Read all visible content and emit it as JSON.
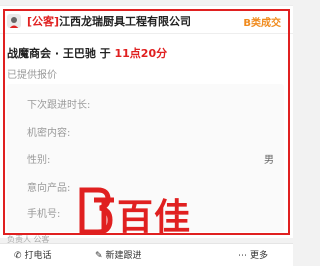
{
  "header": {
    "tag": "[公客]",
    "company": "江西龙瑞厨具工程有限公司",
    "category_badge": "B类成交"
  },
  "activity": {
    "prefix": "战魔商会 · 王巴驰 于 ",
    "time": "11点20分"
  },
  "status_text": "已提供报价",
  "fields": [
    {
      "label": "下次跟进时长:",
      "value": ""
    },
    {
      "label": "机密内容:",
      "value": ""
    },
    {
      "label": "性别:",
      "value": "男"
    },
    {
      "label": "意向产品:",
      "value": ""
    },
    {
      "label": "手机号:",
      "value": ""
    }
  ],
  "owner_label": "负责人 公客",
  "bottom_bar": {
    "call_label": "打电话",
    "new_followup_label": "新建跟进",
    "more_label": "更多"
  },
  "watermark": {
    "text": "百佳"
  },
  "colors": {
    "accent_red": "#e02020",
    "badge_orange": "#f08a1c"
  }
}
